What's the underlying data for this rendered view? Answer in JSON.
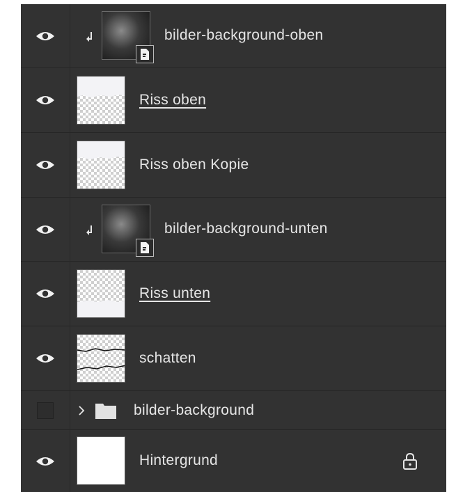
{
  "panel": {
    "layers": [
      {
        "name": "bilder-background-oben",
        "visible": true,
        "kind": "smart-object",
        "clipped": true,
        "underlined": false
      },
      {
        "name": "Riss oben",
        "visible": true,
        "kind": "pixel",
        "clipped": false,
        "underlined": true
      },
      {
        "name": "Riss oben Kopie",
        "visible": true,
        "kind": "pixel",
        "clipped": false,
        "underlined": false
      },
      {
        "name": "bilder-background-unten",
        "visible": true,
        "kind": "smart-object",
        "clipped": true,
        "underlined": false
      },
      {
        "name": "Riss unten",
        "visible": true,
        "kind": "pixel",
        "clipped": false,
        "underlined": true
      },
      {
        "name": "schatten",
        "visible": true,
        "kind": "pixel",
        "clipped": false,
        "underlined": false
      },
      {
        "name": "bilder-background",
        "visible": false,
        "kind": "group",
        "clipped": false,
        "underlined": false
      },
      {
        "name": "Hintergrund",
        "visible": true,
        "kind": "background",
        "clipped": false,
        "underlined": false,
        "locked": true
      }
    ]
  },
  "icons": {
    "visibility": "eye-icon",
    "clip": "clipping-arrow-icon",
    "smart_object": "smart-object-badge-icon",
    "group": "folder-icon",
    "expand": "chevron-right-icon",
    "lock": "lock-icon"
  },
  "colors": {
    "panel_bg": "#323232",
    "text": "#e6e6e6",
    "divider": "#262626"
  }
}
